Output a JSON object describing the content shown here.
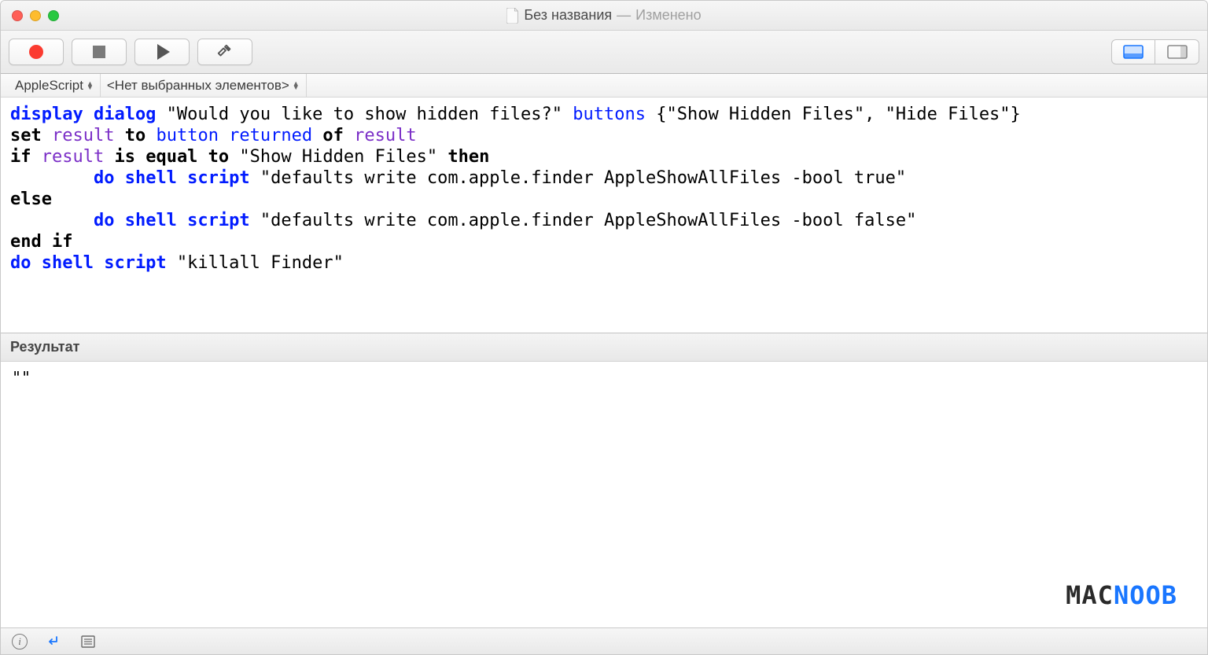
{
  "window": {
    "title": "Без названия",
    "status": "Изменено"
  },
  "toolbar": {
    "record_label": "Record",
    "stop_label": "Stop",
    "run_label": "Run",
    "build_label": "Build"
  },
  "nav": {
    "language": "AppleScript",
    "elements": "<Нет выбранных элементов>"
  },
  "code": {
    "l1_a": "display dialog",
    "l1_b": " \"Would you like to show hidden files?\" ",
    "l1_c": "buttons",
    "l1_d": " {\"Show Hidden Files\", \"Hide Files\"}",
    "l2_a": "set",
    "l2_b": " result ",
    "l2_c": "to",
    "l2_d": " button returned ",
    "l2_e": "of",
    "l2_f": " result",
    "l3_a": "if",
    "l3_b": " result ",
    "l3_c": "is equal to",
    "l3_d": " \"Show Hidden Files\" ",
    "l3_e": "then",
    "l4_a": "\tdo shell script",
    "l4_b": " \"defaults write com.apple.finder AppleShowAllFiles -bool true\"",
    "l5_a": "else",
    "l6_a": "\tdo shell script",
    "l6_b": " \"defaults write com.apple.finder AppleShowAllFiles -bool false\"",
    "l7_a": "end if",
    "l8_a": "do shell script",
    "l8_b": " \"killall Finder\""
  },
  "result": {
    "header": "Результат",
    "output": "\"\""
  },
  "watermark": {
    "part1": "MAC",
    "part2": "NOOB"
  },
  "statusbar": {
    "info": "i"
  }
}
